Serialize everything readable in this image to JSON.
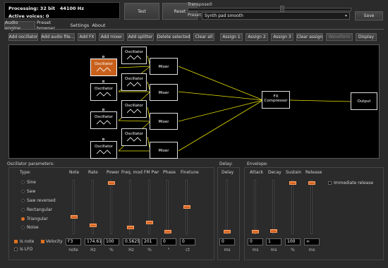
{
  "status": {
    "processing": "Processing: 32 bit",
    "rate": "44100 Hz",
    "voices": "Active voices: 0"
  },
  "header": {
    "test": "Test",
    "reset": "Reset",
    "transpose_label": "Transpose:",
    "transpose_value": "0",
    "preset_label": "Preset:",
    "preset_value": "Synth pad smooth",
    "save": "Save"
  },
  "tabs": [
    "Audio engine",
    "Preset browser",
    "Settings",
    "About"
  ],
  "toolbar": [
    "Add oscillator",
    "Add audio file...",
    "Add FX",
    "Add mixer",
    "Add splitter",
    "Delete selected",
    "Clear all",
    "Assign 1",
    "Assign 2",
    "Assign 3",
    "Clear assign",
    "Waveform",
    "Display"
  ],
  "nodes": {
    "oscillator": "Oscillator",
    "mixer": "Mixer",
    "fx": "FX",
    "fx_sub": "Compressor",
    "output": "Output"
  },
  "params": {
    "title": "Oscillator parameters:",
    "type_label": "Type:",
    "types": [
      "Sine",
      "Saw",
      "Saw reversed",
      "Rectangular",
      "Triangular",
      "Noise"
    ],
    "cols": [
      "Note",
      "Rate",
      "Power",
      "Freq. mod",
      "FM Pwr",
      "Phase",
      "Finetune"
    ],
    "values": [
      "F3",
      "174.61",
      "100",
      "0.5625",
      "201",
      "0",
      "0"
    ],
    "units": [
      "note",
      "Hz",
      "%",
      "Hz",
      "%",
      "°",
      "ct"
    ],
    "is_note": "Is note",
    "velocity": "Velocity",
    "is_lfo": "Is LFO"
  },
  "delay": {
    "title": "Delay:",
    "col": "Delay",
    "value": "0",
    "unit": "ms"
  },
  "envelope": {
    "title": "Envelope:",
    "cols": [
      "Attack",
      "Decay",
      "Sustain",
      "Release"
    ],
    "values": [
      "0",
      "1",
      "100",
      "∞"
    ],
    "units": [
      "ms",
      "ms",
      "%",
      "ms"
    ],
    "immediate": "Immediate release"
  },
  "colors": {
    "accent": "#e07020",
    "graph_bg": "#000000",
    "wire": "#e8e000"
  }
}
